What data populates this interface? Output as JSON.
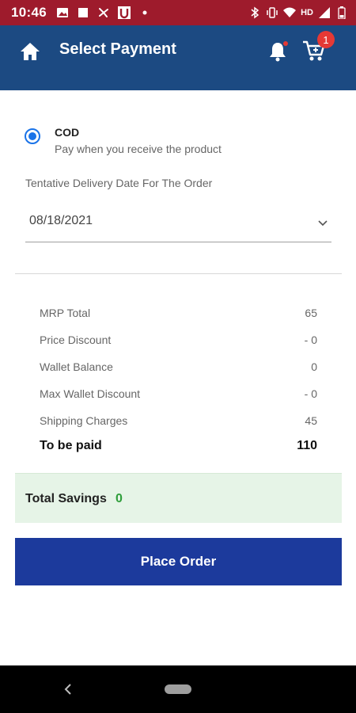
{
  "status_bar": {
    "time": "10:46",
    "network_label": "HD",
    "icons": [
      "gallery-icon",
      "square-icon",
      "fan-icon",
      "u-app-icon",
      "dot-icon",
      "bluetooth-icon",
      "vibrate-icon",
      "wifi-icon",
      "signal-icon",
      "battery-icon"
    ]
  },
  "header": {
    "title": "Select Payment",
    "cart_count": "1",
    "color": "#1c4a82"
  },
  "payment_option": {
    "title": "COD",
    "subtitle": "Pay when you receive the product",
    "selected": true
  },
  "delivery": {
    "label": "Tentative Delivery Date For The Order",
    "selected_date": "08/18/2021"
  },
  "summary": {
    "rows": [
      {
        "label": "MRP Total",
        "value": "65"
      },
      {
        "label": "Price Discount",
        "value": "- 0"
      },
      {
        "label": "Wallet Balance",
        "value": "0"
      },
      {
        "label": "Max Wallet Discount",
        "value": "- 0"
      },
      {
        "label": "Shipping Charges",
        "value": "45"
      }
    ],
    "total_label": "To be paid",
    "total_value": "110"
  },
  "savings": {
    "label": "Total Savings",
    "value": "0",
    "color": "#2e9d3a"
  },
  "place_order": {
    "label": "Place Order",
    "color": "#1c3a9c"
  }
}
